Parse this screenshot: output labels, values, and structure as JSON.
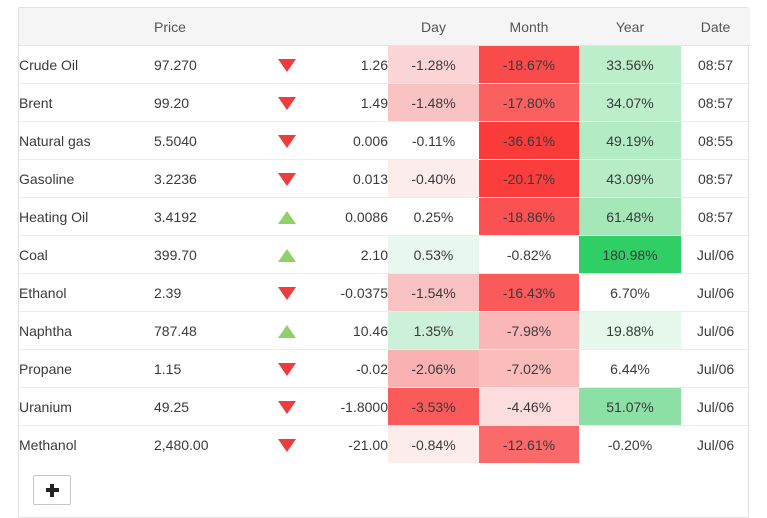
{
  "table": {
    "headers": {
      "name": "",
      "price": "Price",
      "arrow": "",
      "change": "",
      "day": "Day",
      "month": "Month",
      "year": "Year",
      "date": "Date"
    },
    "rows": [
      {
        "name": "Crude Oil",
        "price": "97.270",
        "direction": "down",
        "change": "1.26",
        "change_tone": "down",
        "day": "-1.28%",
        "day_bg": "#fbd5d5",
        "month": "-18.67%",
        "month_bg": "#f94b4b",
        "year": "33.56%",
        "year_bg": "#bdeecb",
        "date": "08:57"
      },
      {
        "name": "Brent",
        "price": "99.20",
        "direction": "down",
        "change": "1.49",
        "change_tone": "down",
        "day": "-1.48%",
        "day_bg": "#fac3c3",
        "month": "-17.80%",
        "month_bg": "#fa6060",
        "year": "34.07%",
        "year_bg": "#bdeecb",
        "date": "08:57"
      },
      {
        "name": "Natural gas",
        "price": "5.5040",
        "direction": "down",
        "change": "0.006",
        "change_tone": "down",
        "day": "-0.11%",
        "day_bg": "#ffffff",
        "month": "-36.61%",
        "month_bg": "#fb3a3a",
        "year": "49.19%",
        "year_bg": "#b3ebc4",
        "date": "08:55"
      },
      {
        "name": "Gasoline",
        "price": "3.2236",
        "direction": "down",
        "change": "0.013",
        "change_tone": "down",
        "day": "-0.40%",
        "day_bg": "#fdecec",
        "month": "-20.17%",
        "month_bg": "#fb3d3d",
        "year": "43.09%",
        "year_bg": "#b8ecc7",
        "date": "08:57"
      },
      {
        "name": "Heating Oil",
        "price": "3.4192",
        "direction": "up",
        "change": "0.0086",
        "change_tone": "up",
        "day": "0.25%",
        "day_bg": "#ffffff",
        "month": "-18.86%",
        "month_bg": "#fa5252",
        "year": "61.48%",
        "year_bg": "#a5e7b8",
        "date": "08:57"
      },
      {
        "name": "Coal",
        "price": "399.70",
        "direction": "up",
        "change": "2.10",
        "change_tone": "flat",
        "day": "0.53%",
        "day_bg": "#e9f8ee",
        "month": "-0.82%",
        "month_bg": "#ffffff",
        "year": "180.98%",
        "year_bg": "#2fcf66",
        "date": "Jul/06"
      },
      {
        "name": "Ethanol",
        "price": "2.39",
        "direction": "down",
        "change": "-0.0375",
        "change_tone": "flat",
        "day": "-1.54%",
        "day_bg": "#fac3c3",
        "month": "-16.43%",
        "month_bg": "#fb5a5a",
        "year": "6.70%",
        "year_bg": "#ffffff",
        "date": "Jul/06"
      },
      {
        "name": "Naphtha",
        "price": "787.48",
        "direction": "up",
        "change": "10.46",
        "change_tone": "flat",
        "day": "1.35%",
        "day_bg": "#cdf1d8",
        "month": "-7.98%",
        "month_bg": "#fbb7b7",
        "year": "19.88%",
        "year_bg": "#e6f8eb",
        "date": "Jul/06"
      },
      {
        "name": "Propane",
        "price": "1.15",
        "direction": "down",
        "change": "-0.02",
        "change_tone": "flat",
        "day": "-2.06%",
        "day_bg": "#fab1b1",
        "month": "-7.02%",
        "month_bg": "#fbbcbc",
        "year": "6.44%",
        "year_bg": "#ffffff",
        "date": "Jul/06"
      },
      {
        "name": "Uranium",
        "price": "49.25",
        "direction": "down",
        "change": "-1.8000",
        "change_tone": "flat",
        "day": "-3.53%",
        "day_bg": "#fa5a5a",
        "month": "-4.46%",
        "month_bg": "#fcdcdc",
        "year": "51.07%",
        "year_bg": "#8ce0a5",
        "date": "Jul/06"
      },
      {
        "name": "Methanol",
        "price": "2,480.00",
        "direction": "down",
        "change": "-21.00",
        "change_tone": "flat",
        "day": "-0.84%",
        "day_bg": "#fdecec",
        "month": "-12.61%",
        "month_bg": "#fa6a6a",
        "year": "-0.20%",
        "year_bg": "#ffffff",
        "date": "Jul/06"
      }
    ]
  },
  "footer": {
    "add_label": "+"
  }
}
